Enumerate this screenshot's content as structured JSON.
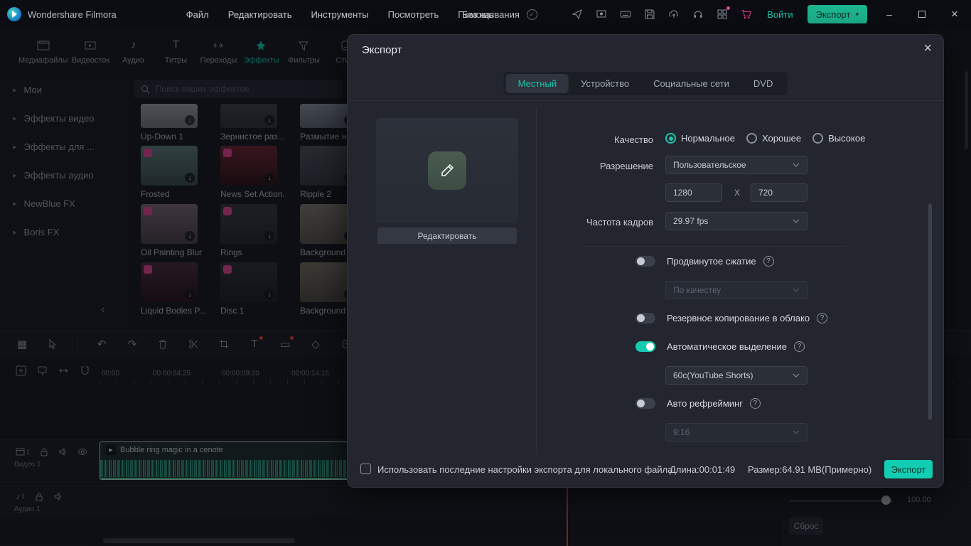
{
  "icons": {
    "question": "?",
    "undo": "↶",
    "redo": "↷",
    "chevron_right": "▸",
    "chevron_down": "▾",
    "collapse": "‹",
    "more": "»",
    "close": "×",
    "minimize": "–",
    "play": "▶",
    "download": "↓",
    "note": "♪",
    "letter_t": "T",
    "grid": "▦",
    "rect": "▭",
    "diamond": "◇",
    "sync": "✓"
  },
  "titlebar": {
    "app_name": "Wondershare Filmora",
    "menus": [
      {
        "label": "Файл"
      },
      {
        "label": "Редактировать"
      },
      {
        "label": "Инструменты"
      },
      {
        "label": "Посмотреть"
      },
      {
        "label": "Помощь"
      }
    ],
    "project_name": "Без названия",
    "login_label": "Войти",
    "export_label": "Экспорт"
  },
  "media_panel": {
    "tabs": [
      {
        "label": "Медиафайлы"
      },
      {
        "label": "Видеосток"
      },
      {
        "label": "Аудио"
      },
      {
        "label": "Титры"
      },
      {
        "label": "Переходы"
      },
      {
        "label": "Эффекты"
      },
      {
        "label": "Фильтры"
      },
      {
        "label": "Стике"
      }
    ],
    "search_placeholder": "Поиск ваших эффектов",
    "categories": [
      {
        "label": "Мои"
      },
      {
        "label": "Эффекты видео"
      },
      {
        "label": "Эффекты для ..."
      },
      {
        "label": "Эффекты аудио"
      },
      {
        "label": "NewBlue FX"
      },
      {
        "label": "Boris FX"
      }
    ],
    "effects": [
      {
        "name": "Up-Down 1"
      },
      {
        "name": "Зернистое раз..."
      },
      {
        "name": "Размытие на..."
      },
      {
        "name": "Frosted"
      },
      {
        "name": "News Set Action..."
      },
      {
        "name": "Ripple 2"
      },
      {
        "name": "Oil Painting Blur"
      },
      {
        "name": "Rings"
      },
      {
        "name": "Background M..."
      },
      {
        "name": "Liquid Bodies P..."
      },
      {
        "name": "Disc 1"
      },
      {
        "name": "Background M..."
      }
    ]
  },
  "timeline": {
    "timecodes": [
      "00:00",
      "00:00:04:25",
      "00:00:09:20",
      "00:00:14:15"
    ],
    "clip_name": "Bubble ring magic in a cenote",
    "video_track_label": "Видео 1",
    "video_track_number": "1",
    "audio_track_label": "Аудио 1",
    "audio_track_number": "1",
    "zoom_value": "100.00",
    "reset_label": "Сброс"
  },
  "export_dialog": {
    "title": "Экспорт",
    "tabs": [
      {
        "label": "Местный"
      },
      {
        "label": "Устройство"
      },
      {
        "label": "Социальные сети"
      },
      {
        "label": "DVD"
      }
    ],
    "edit_button": "Редактировать",
    "quality_label": "Качество",
    "quality_options": [
      {
        "label": "Нормальное"
      },
      {
        "label": "Хорошее"
      },
      {
        "label": "Высокое"
      }
    ],
    "resolution_label": "Разрешение",
    "resolution_value": "Пользовательское",
    "resolution_width": "1280",
    "resolution_separator": "X",
    "resolution_height": "720",
    "framerate_label": "Частота кадров",
    "framerate_value": "29.97 fps",
    "advanced_compression_label": "Продвинутое сжатие",
    "advanced_compression_value": "По качеству",
    "cloud_backup_label": "Резервное копирование в облако",
    "auto_highlight_label": "Автоматическое выделение",
    "auto_highlight_value": "60c(YouTube Shorts)",
    "auto_reframe_label": "Авто рефрейминг",
    "auto_reframe_value": "9:16",
    "footer": {
      "checkbox_label": "Использовать последние настройки экспорта для локального файла",
      "duration": "Длина:00:01:49",
      "size": "Размер:64.91 MB(Примерно)",
      "export_label": "Экспорт"
    }
  },
  "colors": {
    "accent": "#17c9ae",
    "export_button": "#13cdb2",
    "badge_pink": "#e84393",
    "playhead_red": "#e8453c"
  }
}
